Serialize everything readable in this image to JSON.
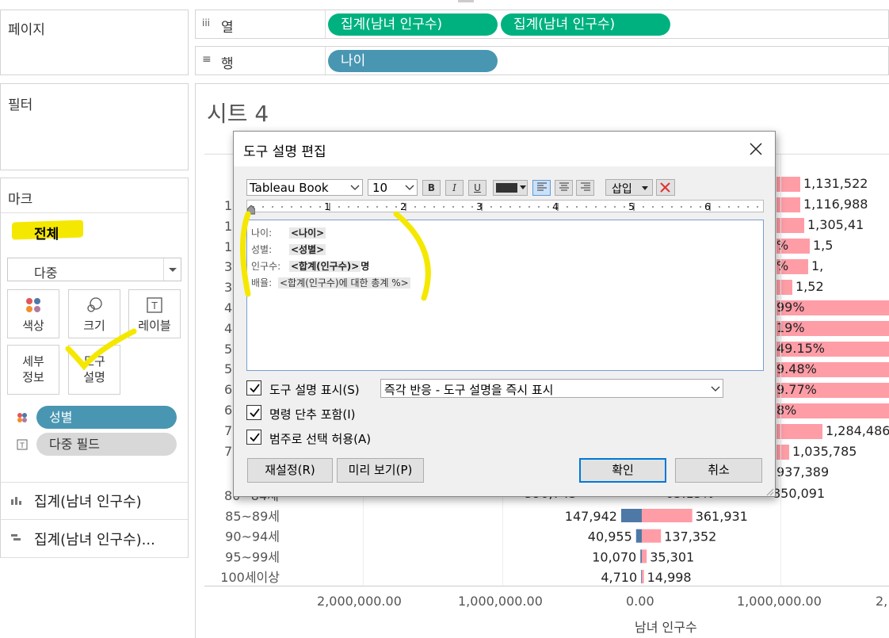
{
  "left": {
    "pages_title": "페이지",
    "filters_title": "필터",
    "marks_title": "마크",
    "all_label": "전체",
    "mark_type": "다중",
    "cards": {
      "color": "색상",
      "size": "크기",
      "label": "레이블",
      "detail": "세부\n정보",
      "tooltip": "도구\n설명"
    },
    "pills": {
      "gender": "성별",
      "multi_field": "다중 필드"
    },
    "measures": [
      "집계(남녀 인구수)",
      "집계(남녀 인구수)..."
    ]
  },
  "shelves": {
    "columns_label": "열",
    "rows_label": "행",
    "columns_pills": [
      "집계(남녀 인구수)",
      "집계(남녀 인구수)"
    ],
    "rows_pill": "나이"
  },
  "sheet_title": "시트 4",
  "chart_data": {
    "type": "bar",
    "categories": [
      "85~89세",
      "90~94세",
      "95~99세",
      "100세이상"
    ],
    "series": [
      {
        "name": "남",
        "values": [
          147942,
          40955,
          10070,
          4710
        ]
      },
      {
        "name": "여",
        "values": [
          361931,
          137352,
          35301,
          14998
        ]
      }
    ],
    "visible_right_values": [
      "1,131,522",
      "1,116,988",
      "1,305,41",
      "1,5",
      "1,",
      "1,52",
      "99%",
      "19%",
      "49.15%",
      "9.48%",
      "9.77%",
      "8%",
      "1,284,486",
      "1,035,785",
      "937,389",
      "850,091"
    ],
    "visible_pct_labels": [
      "%",
      "%"
    ],
    "partial_row_labels": [
      "1",
      "1",
      "1",
      "3",
      "3",
      "4",
      "4",
      "5",
      "5",
      "6",
      "6",
      "7",
      "7",
      "80~84세"
    ],
    "partial_row_left_value": "590,745",
    "partial_row_pct": "63.15%",
    "x_ticks": [
      "2,000,000.00",
      "1,000,000.00",
      "0.00",
      "1,000,000.00",
      "2,"
    ],
    "xlabel": "남녀 인구수",
    "colors": {
      "male": "#4e79a7",
      "female": "#ff9da7"
    }
  },
  "dialog": {
    "title": "도구 설명 편집",
    "font": "Tableau Book",
    "size": "10",
    "bold": "B",
    "italic": "I",
    "underline": "U",
    "insert": "삽입",
    "ruler": [
      "1",
      "2",
      "3",
      "4",
      "5",
      "6"
    ],
    "lines": [
      {
        "label": "나이:",
        "tag": "<나이>",
        "suffix": ""
      },
      {
        "label": "성별:",
        "tag": "<성별>",
        "suffix": ""
      },
      {
        "label": "인구수:",
        "tag": "<합계(인구수)>",
        "suffix": "명"
      },
      {
        "label": "배율:",
        "tag": "<합계(인구수)에 대한 총계 %>",
        "suffix": ""
      }
    ],
    "show_tooltip": "도구 설명 표시(S)",
    "show_mode": "즉각 반응 - 도구 설명을 즉시 표시",
    "include_commands": "명령 단추 포함(I)",
    "allow_category": "범주로 선택 허용(A)",
    "reset": "재설정(R)",
    "preview": "미리 보기(P)",
    "ok": "확인",
    "cancel": "취소"
  }
}
